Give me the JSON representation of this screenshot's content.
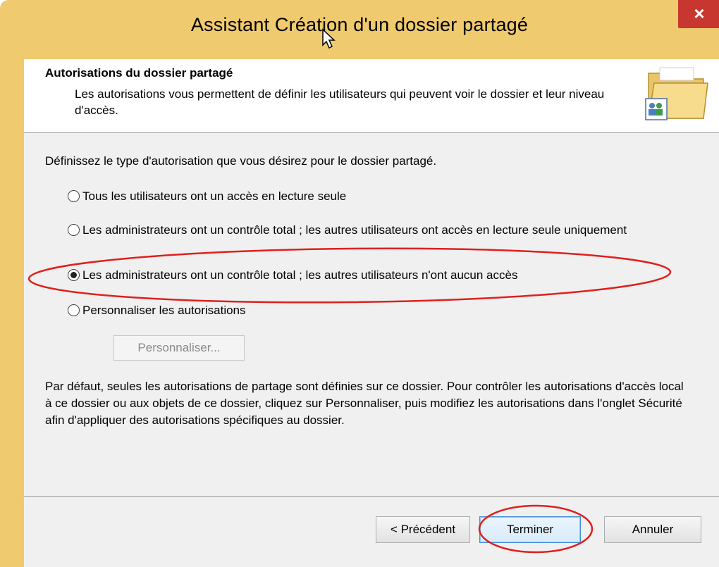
{
  "window": {
    "title": "Assistant Création d'un dossier partagé",
    "close_label": "×"
  },
  "header": {
    "title": "Autorisations du dossier partagé",
    "description": "Les autorisations vous permettent de définir les utilisateurs qui peuvent voir le dossier et leur niveau d'accès."
  },
  "content": {
    "intro": "Définissez le type d'autorisation que vous désirez pour le dossier partagé.",
    "options": [
      {
        "label": "Tous les utilisateurs ont un accès en lecture seule",
        "checked": false
      },
      {
        "label": "Les administrateurs ont un contrôle total ; les autres utilisateurs ont accès en lecture seule uniquement",
        "checked": false
      },
      {
        "label": "Les administrateurs ont un contrôle total ; les autres utilisateurs n'ont aucun accès",
        "checked": true
      },
      {
        "label": "Personnaliser les autorisations",
        "checked": false
      }
    ],
    "customize_button": "Personnaliser...",
    "note": "Par défaut, seules les autorisations de partage sont définies sur ce dossier. Pour contrôler les autorisations d'accès local à ce dossier ou aux objets de ce dossier, cliquez sur Personnaliser, puis modifiez les autorisations dans l'onglet Sécurité afin d'appliquer des autorisations spécifiques au dossier."
  },
  "footer": {
    "previous_button": "< Précédent",
    "finish_button": "Terminer",
    "cancel_button": "Annuler"
  },
  "colors": {
    "frame": "#f0ca6e",
    "close": "#c7372f",
    "annotation": "#e0201e"
  },
  "icons": [
    "close-icon",
    "folder-users-icon",
    "cursor-icon"
  ]
}
